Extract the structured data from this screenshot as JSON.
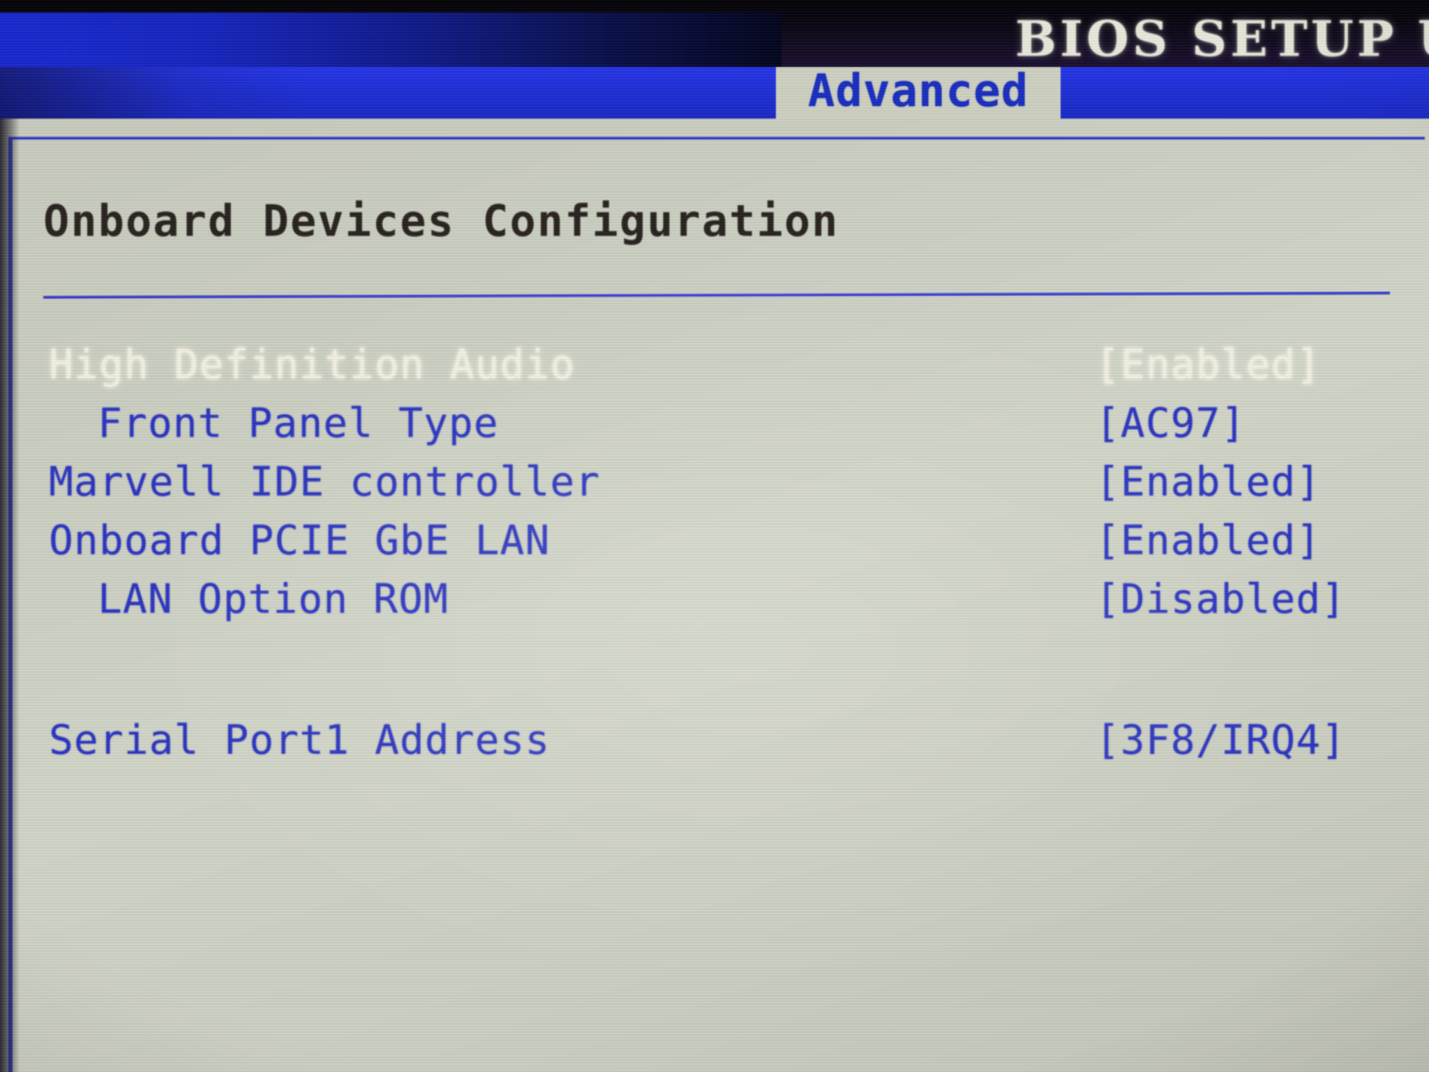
{
  "header": {
    "title": "BIOS SETUP U",
    "menu_tabs": [
      {
        "label": "Advanced",
        "selected": true
      }
    ]
  },
  "panel": {
    "section_heading": "Onboard Devices Configuration"
  },
  "settings": {
    "rows": [
      {
        "label": "High Definition Audio",
        "value": "[Enabled]",
        "indent": 0,
        "selected": true,
        "spacer_before": false
      },
      {
        "label": "Front Panel Type",
        "value": "[AC97]",
        "indent": 1,
        "selected": false,
        "spacer_before": false
      },
      {
        "label": "Marvell IDE controller",
        "value": "[Enabled]",
        "indent": 0,
        "selected": false,
        "spacer_before": false
      },
      {
        "label": "Onboard PCIE GbE LAN",
        "value": "[Enabled]",
        "indent": 0,
        "selected": false,
        "spacer_before": false
      },
      {
        "label": "LAN Option ROM",
        "value": "[Disabled]",
        "indent": 1,
        "selected": false,
        "spacer_before": false
      },
      {
        "label": "Serial Port1 Address",
        "value": "[3F8/IRQ4]",
        "indent": 0,
        "selected": false,
        "spacer_before": true
      }
    ]
  },
  "colors": {
    "text_blue": "#2b34c0",
    "text_selected": "#f2f1e4",
    "heading_dark": "#2a2420",
    "panel_bg": "#ccd0c2",
    "menu_bar_blue": "#2030d8",
    "tab_active_bg": "#cfd2c2",
    "title_band_black": "#0a0712",
    "border_blue": "#3a3fc4"
  }
}
